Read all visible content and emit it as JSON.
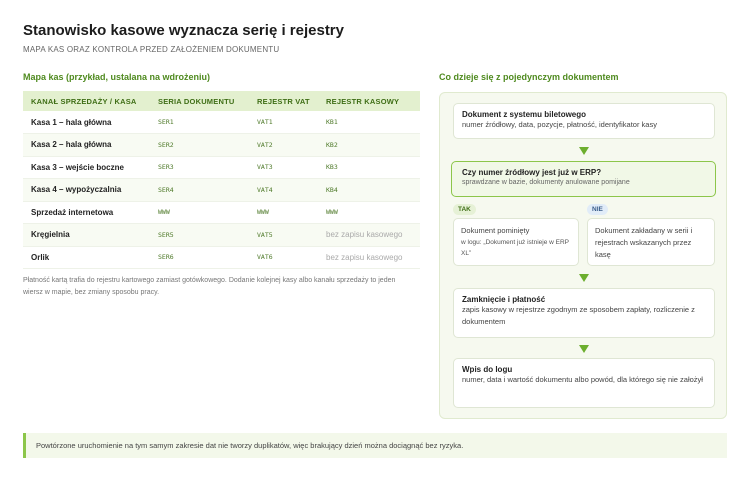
{
  "header": {
    "title": "Stanowisko kasowe wyznacza serię i rejestry",
    "subtitle": "MAPA KAS ORAZ KONTROLA PRZED ZAŁOŻENIEM DOKUMENTU"
  },
  "map": {
    "heading": "Mapa kas (przykład, ustalana na wdrożeniu)",
    "columns": [
      "KANAŁ SPRZEDAŻY / KASA",
      "SERIA DOKUMENTU",
      "REJESTR VAT",
      "REJESTR KASOWY"
    ],
    "rows": [
      {
        "kanal": "Kasa 1 – hala główna",
        "seria": "SER1",
        "vat": "VAT1",
        "kasowy": "KB1"
      },
      {
        "kanal": "Kasa 2 – hala główna",
        "seria": "SER2",
        "vat": "VAT2",
        "kasowy": "KB2"
      },
      {
        "kanal": "Kasa 3 – wejście boczne",
        "seria": "SER3",
        "vat": "VAT3",
        "kasowy": "KB3"
      },
      {
        "kanal": "Kasa 4 – wypożyczalnia",
        "seria": "SER4",
        "vat": "VAT4",
        "kasowy": "KB4"
      },
      {
        "kanal": "Sprzedaż internetowa",
        "seria": "WWW",
        "vat": "WWW",
        "kasowy": "WWW"
      },
      {
        "kanal": "Kręgielnia",
        "seria": "SER5",
        "vat": "VAT5",
        "kasowy": "bez zapisu kasowego"
      },
      {
        "kanal": "Orlik",
        "seria": "SER6",
        "vat": "VAT6",
        "kasowy": "bez zapisu kasowego"
      }
    ],
    "note": "Płatność kartą trafia do rejestru kartowego zamiast gotówkowego. Dodanie kolejnej kasy albo kanału sprzedaży to jeden wiersz w mapie, bez zmiany sposobu pracy."
  },
  "flow": {
    "heading": "Co dzieje się z pojedynczym dokumentem",
    "step1": {
      "title": "Dokument z systemu biletowego",
      "desc": "numer źródłowy, data, pozycje, płatność, identyfikator kasy"
    },
    "check": {
      "title": "Czy numer źródłowy jest już w ERP?",
      "desc": "sprawdzane w bazie, dokumenty anulowane pomijane"
    },
    "yes": {
      "tag": "TAK",
      "title": "Dokument pominięty",
      "desc": "w logu: „Dokument już istnieje w ERP XL”"
    },
    "no": {
      "tag": "NIE",
      "desc": "Dokument zakładany w serii i rejestrach wskazanych przez kasę"
    },
    "step3": {
      "title": "Zamknięcie i płatność",
      "desc": "zapis kasowy w rejestrze zgodnym ze sposobem zapłaty, rozliczenie z dokumentem"
    },
    "step4": {
      "title": "Wpis do logu",
      "desc": "numer, data i wartość dokumentu albo powód, dla którego się nie założył"
    }
  },
  "footer": {
    "text": "Powtórzone uruchomienie na tym samym zakresie dat nie tworzy duplikatów, więc brakujący dzień można dociągnąć bez ryzyka."
  },
  "colors": {
    "accent": "#6cae2e",
    "heading": "#4f8a1f",
    "header_bg": "#e3f0cf"
  }
}
